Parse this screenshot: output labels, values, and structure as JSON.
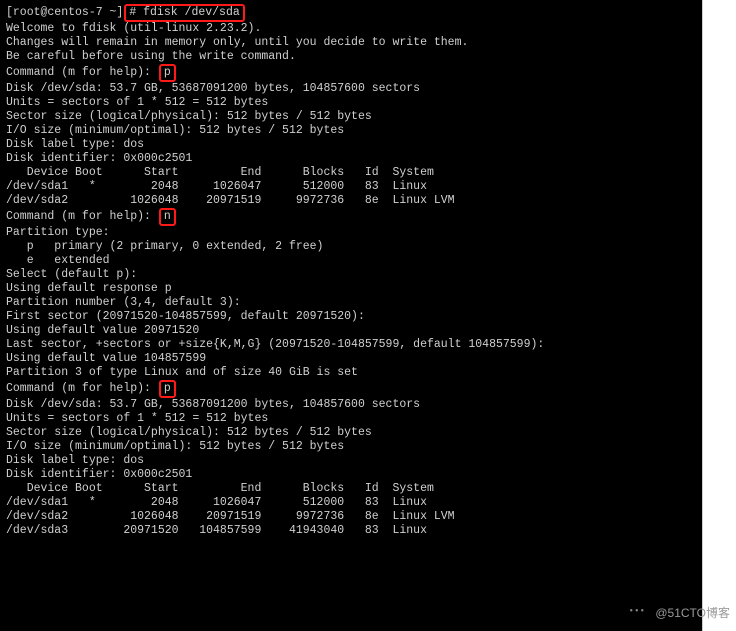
{
  "prompt_line": {
    "prefix": "[root@centos-7 ~]",
    "cmd": "# fdisk /dev/sda"
  },
  "welcome": "Welcome to fdisk (util-linux 2.23.2).",
  "blank": "",
  "warn1": "Changes will remain in memory only, until you decide to write them.",
  "warn2": "Be careful before using the write command.",
  "cmd_label": "Command (m for help): ",
  "p1": "p",
  "n1": "n",
  "p2": "p",
  "disk_info": [
    "Disk /dev/sda: 53.7 GB, 53687091200 bytes, 104857600 sectors",
    "Units = sectors of 1 * 512 = 512 bytes",
    "Sector size (logical/physical): 512 bytes / 512 bytes",
    "I/O size (minimum/optimal): 512 bytes / 512 bytes",
    "Disk label type: dos",
    "Disk identifier: 0x000c2501"
  ],
  "table1_header": "   Device Boot      Start         End      Blocks   Id  System",
  "table1_rows": [
    "/dev/sda1   *        2048     1026047      512000   83  Linux",
    "/dev/sda2         1026048    20971519     9972736   8e  Linux LVM"
  ],
  "new_part": [
    "Partition type:",
    "   p   primary (2 primary, 0 extended, 2 free)",
    "   e   extended",
    "Select (default p):",
    "Using default response p",
    "Partition number (3,4, default 3):",
    "First sector (20971520-104857599, default 20971520):",
    "Using default value 20971520",
    "Last sector, +sectors or +size{K,M,G} (20971520-104857599, default 104857599):",
    "Using default value 104857599",
    "Partition 3 of type Linux and of size 40 GiB is set"
  ],
  "table2_header": "   Device Boot      Start         End      Blocks   Id  System",
  "table2_rows": [
    "/dev/sda1   *        2048     1026047      512000   83  Linux",
    "/dev/sda2         1026048    20971519     9972736   8e  Linux LVM",
    "/dev/sda3        20971520   104857599    41943040   83  Linux"
  ],
  "watermark": "@51CTO博客"
}
